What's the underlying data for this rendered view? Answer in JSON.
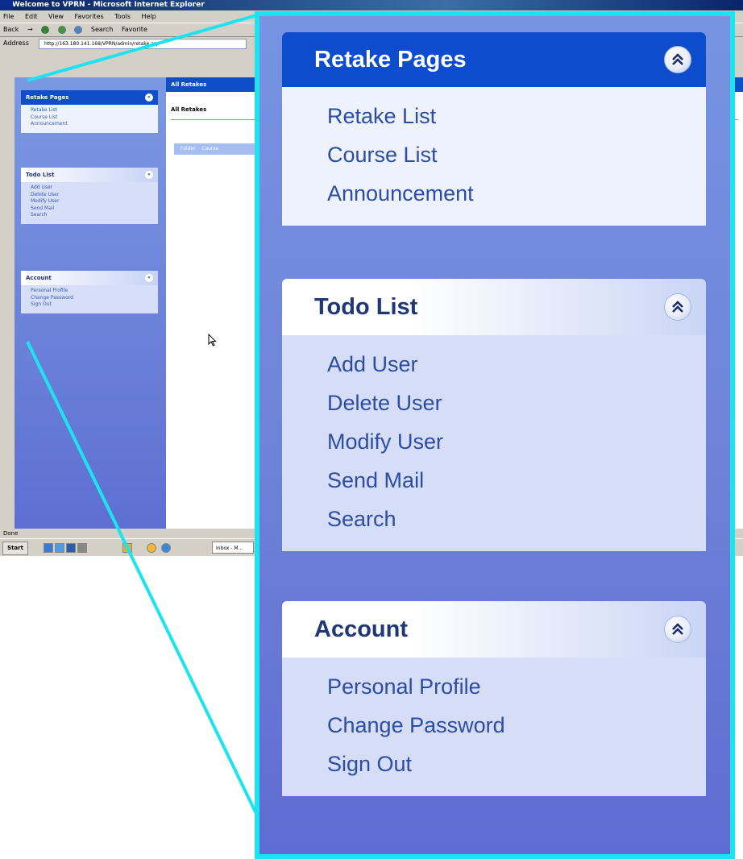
{
  "browser": {
    "title": "Welcome to VPRN - Microsoft Internet Explorer",
    "menu": [
      "File",
      "Edit",
      "View",
      "Favorites",
      "Tools",
      "Help"
    ],
    "toolbar": {
      "back": "Back",
      "search": "Search",
      "favorites": "Favorite"
    },
    "address_label": "Address",
    "address_value": "http://163.180.141.168/VPRN/admin/retake.asp",
    "status": "Done"
  },
  "taskbar": {
    "start": "Start",
    "inbox": "Inbox - M..."
  },
  "page": {
    "content_header": "All Retakes",
    "content_subtitle": "All Retakes",
    "table_headers": [
      "Folder",
      "Course"
    ]
  },
  "sidebar": {
    "sections": [
      {
        "title": "Retake Pages",
        "style": "dark",
        "items": [
          "Retake List",
          "Course List",
          "Announcement"
        ]
      },
      {
        "title": "Todo List",
        "style": "light",
        "items": [
          "Add User",
          "Delete User",
          "Modify User",
          "Send Mail",
          "Search"
        ]
      },
      {
        "title": "Account",
        "style": "light",
        "items": [
          "Personal Profile",
          "Change Password",
          "Sign Out"
        ]
      }
    ]
  },
  "icons": {
    "collapse": "chevron-double-up-icon",
    "cursor": "mouse-pointer-icon"
  },
  "colors": {
    "highlight_frame": "#1de3ef",
    "header_dark": "#0d4ccc",
    "header_text_light": "#1f3677",
    "link": "#2c4ca6",
    "sidebar_bg": "#6f84d8"
  }
}
